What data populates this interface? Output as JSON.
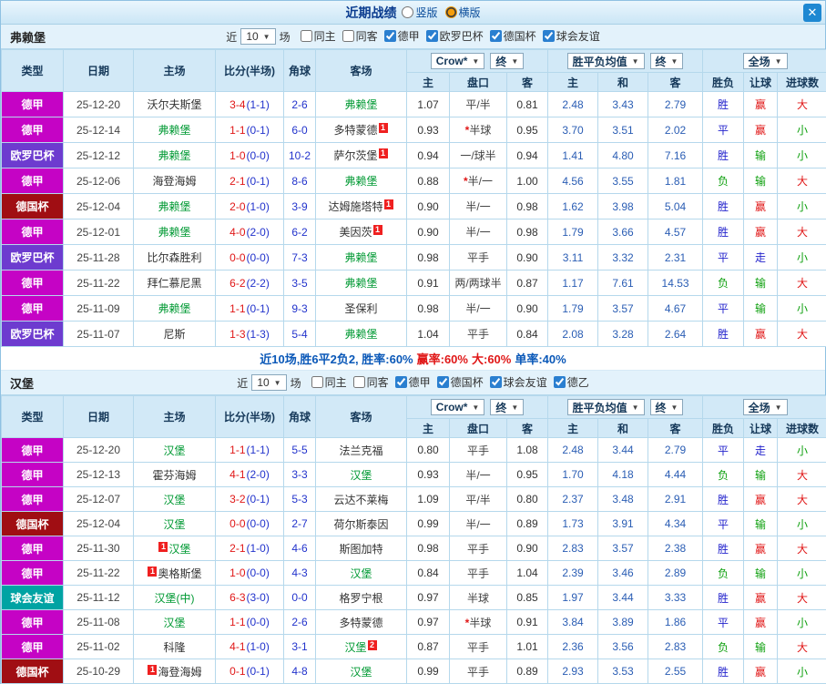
{
  "titlebar": {
    "title": "近期战绩",
    "layout_options": [
      {
        "label": "竖版",
        "selected": false
      },
      {
        "label": "横版",
        "selected": true
      }
    ],
    "close_icon": "✕"
  },
  "league_colors": {
    "德甲": "#c503c5",
    "欧罗巴杯": "#6d3bcf",
    "德国杯": "#a00e13",
    "球会友谊": "#00a3a3"
  },
  "result_colors": {
    "胜": "#2222cc",
    "平": "#2222cc",
    "负": "#0ea00e",
    "赢": "#e01717",
    "输": "#0ea00e",
    "走": "#2222cc",
    "大": "#e01717",
    "小": "#0ea00e"
  },
  "summary": {
    "segments": [
      {
        "text": "近10场,胜6平2负2, 胜率:60%",
        "color": "#0a58b8"
      },
      {
        "text": " 赢率:60%",
        "color": "#e01717"
      },
      {
        "text": " 大:60%",
        "color": "#e01717"
      },
      {
        "text": " 单率:40%",
        "color": "#0a58b8"
      }
    ]
  },
  "sections": [
    {
      "team": "弗赖堡",
      "filter": {
        "prefix": "近",
        "count": "10",
        "suffix": "场",
        "checkboxes": [
          {
            "label": "同主",
            "checked": false
          },
          {
            "label": "同客",
            "checked": false
          },
          {
            "label": "德甲",
            "checked": true
          },
          {
            "label": "欧罗巴杯",
            "checked": true
          },
          {
            "label": "德国杯",
            "checked": true
          },
          {
            "label": "球会友谊",
            "checked": true
          }
        ]
      },
      "header": {
        "type": "类型",
        "date": "日期",
        "home": "主场",
        "score": "比分(半场)",
        "corner": "角球",
        "away": "客场",
        "odds_source": "Crow*",
        "odds_final": "终",
        "euro_avg": "胜平负均值",
        "euro_final": "终",
        "scope": "全场",
        "sub": [
          "主",
          "盘口",
          "客",
          "主",
          "和",
          "客",
          "胜负",
          "让球",
          "进球数"
        ]
      },
      "rows": [
        {
          "type": "德甲",
          "date": "25-12-20",
          "home": "沃尔夫斯堡",
          "score": "3-4",
          "half": "(1-1)",
          "corner": "2-6",
          "away": "弗赖堡",
          "away_focus": true,
          "ah_home": "1.07",
          "handicap": "平/半",
          "ah_away": "0.81",
          "eu_home": "2.48",
          "eu_draw": "3.43",
          "eu_away": "2.79",
          "result": "胜",
          "handicap_result": "赢",
          "goals": "大"
        },
        {
          "type": "德甲",
          "date": "25-12-14",
          "home": "弗赖堡",
          "home_focus": true,
          "score": "1-1",
          "half": "(0-1)",
          "corner": "6-0",
          "away": "多特蒙德",
          "away_badge": "1",
          "away_badge_side": "right",
          "ah_home": "0.93",
          "handicap": "*半球",
          "ah_away": "0.95",
          "eu_home": "3.70",
          "eu_draw": "3.51",
          "eu_away": "2.02",
          "result": "平",
          "handicap_result": "赢",
          "goals": "小"
        },
        {
          "type": "欧罗巴杯",
          "date": "25-12-12",
          "home": "弗赖堡",
          "home_focus": true,
          "score": "1-0",
          "half": "(0-0)",
          "corner": "10-2",
          "away": "萨尔茨堡",
          "away_badge": "1",
          "away_badge_side": "right",
          "ah_home": "0.94",
          "handicap": "一/球半",
          "ah_away": "0.94",
          "eu_home": "1.41",
          "eu_draw": "4.80",
          "eu_away": "7.16",
          "result": "胜",
          "handicap_result": "输",
          "goals": "小"
        },
        {
          "type": "德甲",
          "date": "25-12-06",
          "home": "海登海姆",
          "score": "2-1",
          "half": "(0-1)",
          "corner": "8-6",
          "away": "弗赖堡",
          "away_focus": true,
          "ah_home": "0.88",
          "handicap": "*半/一",
          "ah_away": "1.00",
          "eu_home": "4.56",
          "eu_draw": "3.55",
          "eu_away": "1.81",
          "result": "负",
          "handicap_result": "输",
          "goals": "大"
        },
        {
          "type": "德国杯",
          "date": "25-12-04",
          "home": "弗赖堡",
          "home_focus": true,
          "score": "2-0",
          "half": "(1-0)",
          "corner": "3-9",
          "away": "达姆施塔特",
          "away_badge": "1",
          "away_badge_side": "right",
          "ah_home": "0.90",
          "handicap": "半/一",
          "ah_away": "0.98",
          "eu_home": "1.62",
          "eu_draw": "3.98",
          "eu_away": "5.04",
          "result": "胜",
          "handicap_result": "赢",
          "goals": "小"
        },
        {
          "type": "德甲",
          "date": "25-12-01",
          "home": "弗赖堡",
          "home_focus": true,
          "score": "4-0",
          "half": "(2-0)",
          "corner": "6-2",
          "away": "美因茨",
          "away_badge": "1",
          "away_badge_side": "right",
          "ah_home": "0.90",
          "handicap": "半/一",
          "ah_away": "0.98",
          "eu_home": "1.79",
          "eu_draw": "3.66",
          "eu_away": "4.57",
          "result": "胜",
          "handicap_result": "赢",
          "goals": "大"
        },
        {
          "type": "欧罗巴杯",
          "date": "25-11-28",
          "home": "比尔森胜利",
          "score": "0-0",
          "half": "(0-0)",
          "corner": "7-3",
          "away": "弗赖堡",
          "away_focus": true,
          "ah_home": "0.98",
          "handicap": "平手",
          "ah_away": "0.90",
          "eu_home": "3.11",
          "eu_draw": "3.32",
          "eu_away": "2.31",
          "result": "平",
          "handicap_result": "走",
          "goals": "小"
        },
        {
          "type": "德甲",
          "date": "25-11-22",
          "home": "拜仁慕尼黑",
          "score": "6-2",
          "half": "(2-2)",
          "corner": "3-5",
          "away": "弗赖堡",
          "away_focus": true,
          "ah_home": "0.91",
          "handicap": "两/两球半",
          "ah_away": "0.87",
          "eu_home": "1.17",
          "eu_draw": "7.61",
          "eu_away": "14.53",
          "result": "负",
          "handicap_result": "输",
          "goals": "大"
        },
        {
          "type": "德甲",
          "date": "25-11-09",
          "home": "弗赖堡",
          "home_focus": true,
          "score": "1-1",
          "half": "(0-1)",
          "corner": "9-3",
          "away": "圣保利",
          "ah_home": "0.98",
          "handicap": "半/一",
          "ah_away": "0.90",
          "eu_home": "1.79",
          "eu_draw": "3.57",
          "eu_away": "4.67",
          "result": "平",
          "handicap_result": "输",
          "goals": "小"
        },
        {
          "type": "欧罗巴杯",
          "date": "25-11-07",
          "home": "尼斯",
          "score": "1-3",
          "half": "(1-3)",
          "corner": "5-4",
          "away": "弗赖堡",
          "away_focus": true,
          "ah_home": "1.04",
          "handicap": "平手",
          "ah_away": "0.84",
          "eu_home": "2.08",
          "eu_draw": "3.28",
          "eu_away": "2.64",
          "result": "胜",
          "handicap_result": "赢",
          "goals": "大"
        }
      ]
    },
    {
      "team": "汉堡",
      "filter": {
        "prefix": "近",
        "count": "10",
        "suffix": "场",
        "checkboxes": [
          {
            "label": "同主",
            "checked": false
          },
          {
            "label": "同客",
            "checked": false
          },
          {
            "label": "德甲",
            "checked": true
          },
          {
            "label": "德国杯",
            "checked": true
          },
          {
            "label": "球会友谊",
            "checked": true
          },
          {
            "label": "德乙",
            "checked": true
          }
        ]
      },
      "header": {
        "type": "类型",
        "date": "日期",
        "home": "主场",
        "score": "比分(半场)",
        "corner": "角球",
        "away": "客场",
        "odds_source": "Crow*",
        "odds_final": "终",
        "euro_avg": "胜平负均值",
        "euro_final": "终",
        "scope": "全场",
        "sub": [
          "主",
          "盘口",
          "客",
          "主",
          "和",
          "客",
          "胜负",
          "让球",
          "进球数"
        ]
      },
      "rows": [
        {
          "type": "德甲",
          "date": "25-12-20",
          "home": "汉堡",
          "home_focus": true,
          "score": "1-1",
          "half": "(1-1)",
          "corner": "5-5",
          "away": "法兰克福",
          "ah_home": "0.80",
          "handicap": "平手",
          "ah_away": "1.08",
          "eu_home": "2.48",
          "eu_draw": "3.44",
          "eu_away": "2.79",
          "result": "平",
          "handicap_result": "走",
          "goals": "小"
        },
        {
          "type": "德甲",
          "date": "25-12-13",
          "home": "霍芬海姆",
          "score": "4-1",
          "half": "(2-0)",
          "corner": "3-3",
          "away": "汉堡",
          "away_focus": true,
          "ah_home": "0.93",
          "handicap": "半/一",
          "ah_away": "0.95",
          "eu_home": "1.70",
          "eu_draw": "4.18",
          "eu_away": "4.44",
          "result": "负",
          "handicap_result": "输",
          "goals": "大"
        },
        {
          "type": "德甲",
          "date": "25-12-07",
          "home": "汉堡",
          "home_focus": true,
          "score": "3-2",
          "half": "(0-1)",
          "corner": "5-3",
          "away": "云达不莱梅",
          "ah_home": "1.09",
          "handicap": "平/半",
          "ah_away": "0.80",
          "eu_home": "2.37",
          "eu_draw": "3.48",
          "eu_away": "2.91",
          "result": "胜",
          "handicap_result": "赢",
          "goals": "大"
        },
        {
          "type": "德国杯",
          "date": "25-12-04",
          "home": "汉堡",
          "home_focus": true,
          "score": "0-0",
          "half": "(0-0)",
          "corner": "2-7",
          "away": "荷尔斯泰因",
          "ah_home": "0.99",
          "handicap": "半/一",
          "ah_away": "0.89",
          "eu_home": "1.73",
          "eu_draw": "3.91",
          "eu_away": "4.34",
          "result": "平",
          "handicap_result": "输",
          "goals": "小"
        },
        {
          "type": "德甲",
          "date": "25-11-30",
          "home": "汉堡",
          "home_focus": true,
          "home_badge": "1",
          "home_badge_side": "left",
          "score": "2-1",
          "half": "(1-0)",
          "corner": "4-6",
          "away": "斯图加特",
          "ah_home": "0.98",
          "handicap": "平手",
          "ah_away": "0.90",
          "eu_home": "2.83",
          "eu_draw": "3.57",
          "eu_away": "2.38",
          "result": "胜",
          "handicap_result": "赢",
          "goals": "大"
        },
        {
          "type": "德甲",
          "date": "25-11-22",
          "home": "奥格斯堡",
          "home_badge": "1",
          "home_badge_side": "left",
          "score": "1-0",
          "half": "(0-0)",
          "corner": "4-3",
          "away": "汉堡",
          "away_focus": true,
          "ah_home": "0.84",
          "handicap": "平手",
          "ah_away": "1.04",
          "eu_home": "2.39",
          "eu_draw": "3.46",
          "eu_away": "2.89",
          "result": "负",
          "handicap_result": "输",
          "goals": "小"
        },
        {
          "type": "球会友谊",
          "date": "25-11-12",
          "home": "汉堡(中)",
          "home_focus": true,
          "score": "6-3",
          "half": "(3-0)",
          "corner": "0-0",
          "away": "格罗宁根",
          "ah_home": "0.97",
          "handicap": "半球",
          "ah_away": "0.85",
          "eu_home": "1.97",
          "eu_draw": "3.44",
          "eu_away": "3.33",
          "result": "胜",
          "handicap_result": "赢",
          "goals": "大"
        },
        {
          "type": "德甲",
          "date": "25-11-08",
          "home": "汉堡",
          "home_focus": true,
          "score": "1-1",
          "half": "(0-0)",
          "corner": "2-6",
          "away": "多特蒙德",
          "ah_home": "0.97",
          "handicap": "*半球",
          "ah_away": "0.91",
          "eu_home": "3.84",
          "eu_draw": "3.89",
          "eu_away": "1.86",
          "result": "平",
          "handicap_result": "赢",
          "goals": "小"
        },
        {
          "type": "德甲",
          "date": "25-11-02",
          "home": "科隆",
          "score": "4-1",
          "half": "(1-0)",
          "corner": "3-1",
          "away": "汉堡",
          "away_focus": true,
          "away_badge": "2",
          "away_badge_side": "right",
          "ah_home": "0.87",
          "handicap": "平手",
          "ah_away": "1.01",
          "eu_home": "2.36",
          "eu_draw": "3.56",
          "eu_away": "2.83",
          "result": "负",
          "handicap_result": "输",
          "goals": "大"
        },
        {
          "type": "德国杯",
          "date": "25-10-29",
          "home": "海登海姆",
          "home_badge": "1",
          "home_badge_side": "left",
          "score": "0-1",
          "half": "(0-1)",
          "corner": "4-8",
          "away": "汉堡",
          "away_focus": true,
          "ah_home": "0.99",
          "handicap": "平手",
          "ah_away": "0.89",
          "eu_home": "2.93",
          "eu_draw": "3.53",
          "eu_away": "2.55",
          "result": "胜",
          "handicap_result": "赢",
          "goals": "小"
        }
      ]
    }
  ]
}
